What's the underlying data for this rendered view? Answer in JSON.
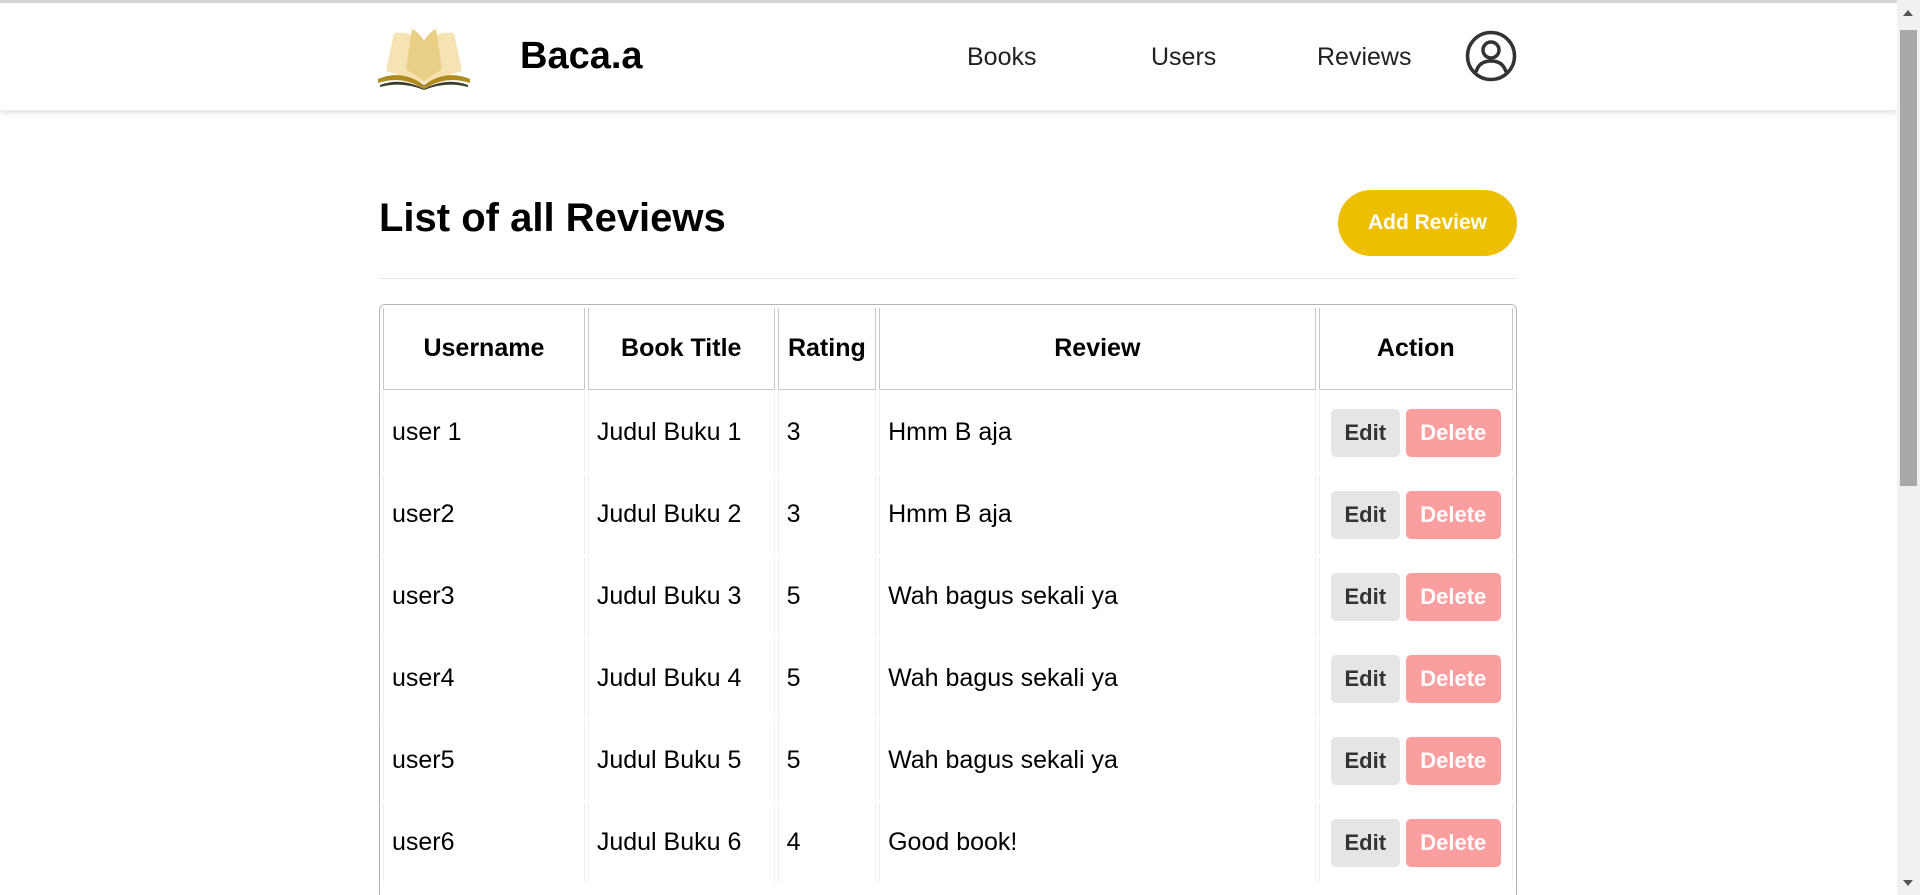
{
  "navbar": {
    "brand": "Baca.a",
    "links": [
      "Books",
      "Users",
      "Reviews"
    ],
    "logo_colors": [
      "#f6e3b4",
      "#e9cf86",
      "#b08b1e",
      "#3b3b2a"
    ],
    "profile_icon": "user-circle-icon"
  },
  "page": {
    "title": "List of all Reviews",
    "add_button": "Add Review"
  },
  "table": {
    "headers": [
      "Username",
      "Book Title",
      "Rating",
      "Review",
      "Action"
    ],
    "rows": [
      {
        "username": "user 1",
        "book_title": "Judul Buku 1",
        "rating": "3",
        "review": "Hmm B aja"
      },
      {
        "username": "user2",
        "book_title": "Judul Buku 2",
        "rating": "3",
        "review": "Hmm B aja"
      },
      {
        "username": "user3",
        "book_title": "Judul Buku 3",
        "rating": "5",
        "review": "Wah bagus sekali ya"
      },
      {
        "username": "user4",
        "book_title": "Judul Buku 4",
        "rating": "5",
        "review": "Wah bagus sekali ya"
      },
      {
        "username": "user5",
        "book_title": "Judul Buku 5",
        "rating": "5",
        "review": "Wah bagus sekali ya"
      },
      {
        "username": "user6",
        "book_title": "Judul Buku 6",
        "rating": "4",
        "review": "Good book!"
      }
    ],
    "edit_label": "Edit",
    "delete_label": "Delete"
  },
  "colors": {
    "accent": "#eebf00",
    "delete": "#fb9ea0",
    "edit": "#e5e5e5"
  }
}
